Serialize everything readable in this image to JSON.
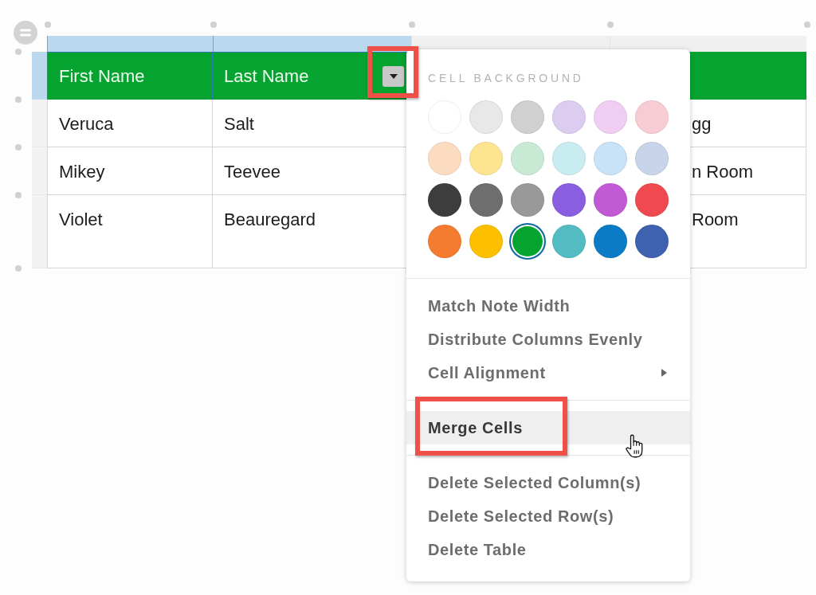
{
  "table": {
    "header_selected": true,
    "columns": [
      {
        "label": "First Name",
        "selected": true
      },
      {
        "label": "Last Name",
        "selected": true,
        "menu_button": {
          "highlighted": true
        }
      },
      {
        "selected": false
      },
      {
        "selected": false
      }
    ],
    "rows": [
      {
        "selected": false,
        "first_name": "Veruca",
        "last_name": "Salt",
        "column_4": "gg"
      },
      {
        "selected": false,
        "first_name": "Mikey",
        "last_name": "Teevee",
        "column_4": "n Room"
      },
      {
        "selected": false,
        "first_name": "Violet",
        "last_name": "Beauregard",
        "column_4": "Room"
      }
    ]
  },
  "cell_menu": {
    "section_title": "CELL BACKGROUND",
    "swatches": [
      {
        "color": "#ffffff",
        "selected": false
      },
      {
        "color": "#e8e8e8",
        "selected": false
      },
      {
        "color": "#d0d0d0",
        "selected": false
      },
      {
        "color": "#dccdf0",
        "selected": false
      },
      {
        "color": "#f0cdf2",
        "selected": false
      },
      {
        "color": "#f8ccd4",
        "selected": false
      },
      {
        "color": "#fcdcc0",
        "selected": false
      },
      {
        "color": "#fce491",
        "selected": false
      },
      {
        "color": "#c8ead4",
        "selected": false
      },
      {
        "color": "#c8ecef",
        "selected": false
      },
      {
        "color": "#c8e2f8",
        "selected": false
      },
      {
        "color": "#c8d4ea",
        "selected": false
      },
      {
        "color": "#3d3d3d",
        "selected": false
      },
      {
        "color": "#6e6e6e",
        "selected": false
      },
      {
        "color": "#999999",
        "selected": false
      },
      {
        "color": "#8a5ee0",
        "selected": false
      },
      {
        "color": "#c25ad6",
        "selected": false
      },
      {
        "color": "#f04a50",
        "selected": false
      },
      {
        "color": "#f47c30",
        "selected": false
      },
      {
        "color": "#fcc000",
        "selected": false
      },
      {
        "color": "#05a431",
        "selected": true
      },
      {
        "color": "#52bcc2",
        "selected": false
      },
      {
        "color": "#0a7bc4",
        "selected": false
      },
      {
        "color": "#3f62b0",
        "selected": false
      }
    ],
    "groups": [
      {
        "items": [
          {
            "label": "Match Note Width",
            "submenu": false,
            "hovered": false,
            "highlighted": false
          },
          {
            "label": "Distribute Columns Evenly",
            "submenu": false,
            "hovered": false,
            "highlighted": false
          },
          {
            "label": "Cell Alignment",
            "submenu": true,
            "hovered": false,
            "highlighted": false
          }
        ]
      },
      {
        "items": [
          {
            "label": "Merge Cells",
            "submenu": false,
            "hovered": true,
            "highlighted": true
          }
        ]
      },
      {
        "items": [
          {
            "label": "Delete Selected Column(s)",
            "submenu": false,
            "hovered": false,
            "highlighted": false
          },
          {
            "label": "Delete Selected Row(s)",
            "submenu": false,
            "hovered": false,
            "highlighted": false
          },
          {
            "label": "Delete Table",
            "submenu": false,
            "hovered": false,
            "highlighted": false
          }
        ]
      }
    ]
  }
}
